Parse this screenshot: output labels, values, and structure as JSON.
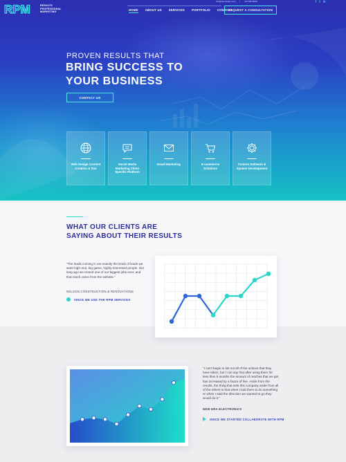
{
  "header": {
    "logo_text": "RPM",
    "logo_tagline": [
      "RESULTS",
      "PROFESSIONAL",
      "MARKETING"
    ],
    "top_info": [
      "info@rpmdesign.com",
      "|",
      "407.555.0000"
    ],
    "nav": [
      {
        "label": "HOME",
        "active": true
      },
      {
        "label": "ABOUT US",
        "active": false
      },
      {
        "label": "SERVICES",
        "active": false
      },
      {
        "label": "PORTFOLIO",
        "active": false
      },
      {
        "label": "CONTACT",
        "active": false
      }
    ],
    "cta_label": "REQUEST A CONSULTATION",
    "social_icons": [
      "facebook-icon",
      "twitter-icon",
      "linkedin-icon"
    ]
  },
  "hero": {
    "subtitle": "PROVEN RESULTS THAT",
    "title_line1": "BRING SUCCESS TO",
    "title_line2": "YOUR BUSINESS",
    "contact_label": "CONTACT US"
  },
  "services": [
    {
      "label": "Web Design Content Creation & Seo",
      "icon": "globe-icon"
    },
    {
      "label": "Social Media Marketing Client Specific Platform",
      "icon": "chat-bubble-icon"
    },
    {
      "label": "Email Marketing",
      "icon": "envelope-icon"
    },
    {
      "label": "E-commerce Solutions",
      "icon": "cart-icon"
    },
    {
      "label": "Custom Software & System Development",
      "icon": "gear-icon"
    }
  ],
  "testimonials_section": {
    "title_line1": "WHAT OUR CLIENTS ARE",
    "title_line2": "SAYING ABOUT THEIR RESULTS"
  },
  "testimonial1": {
    "quote": "\"The leads coming in are exactly the kinds of leads we want-high-end, big-game, highly-interested people. Not long ago we closed one of our biggest jobs ever, and that reach came from the website.\"",
    "author": "NELSON CONSTRUCTION & RENOVATIONS",
    "since": "SINCE WE USE THE RPM SERVICES"
  },
  "testimonial2": {
    "quote": "\"I can't begin to list out all of the actions that they have taken, but I can say that after using them for less than 6 months the amount of reaches that we get has increased by a factor of five. Aside from the results, the thing that sets this company aside from all of the others is that when I told them to do something or when I said the direction we wanted to go they would do it.\"",
    "author": "NEW ERA ELECTRONICS",
    "since": "SINCE WE STARTED COLLABORATE WITH RPM"
  },
  "colors": {
    "accent": "#23d8c4",
    "brand_blue": "#2a2aa0",
    "hero_top": "#2b2fb0",
    "hero_bottom": "#15c3c4"
  },
  "chart_data": [
    {
      "type": "line",
      "x": [
        1,
        2,
        3,
        4,
        5,
        6,
        7,
        8
      ],
      "y": [
        1,
        5,
        5,
        2,
        5,
        5,
        7.5,
        8.5
      ],
      "ylim": [
        0,
        10
      ],
      "grid": true
    },
    {
      "type": "area",
      "x": [
        1,
        2,
        3,
        4,
        5,
        6,
        7,
        8,
        9
      ],
      "y": [
        3.5,
        3.7,
        3.5,
        2.8,
        4.2,
        5.5,
        5.0,
        6.5,
        9.0
      ],
      "ylim": [
        0,
        11
      ],
      "grid": false
    }
  ]
}
